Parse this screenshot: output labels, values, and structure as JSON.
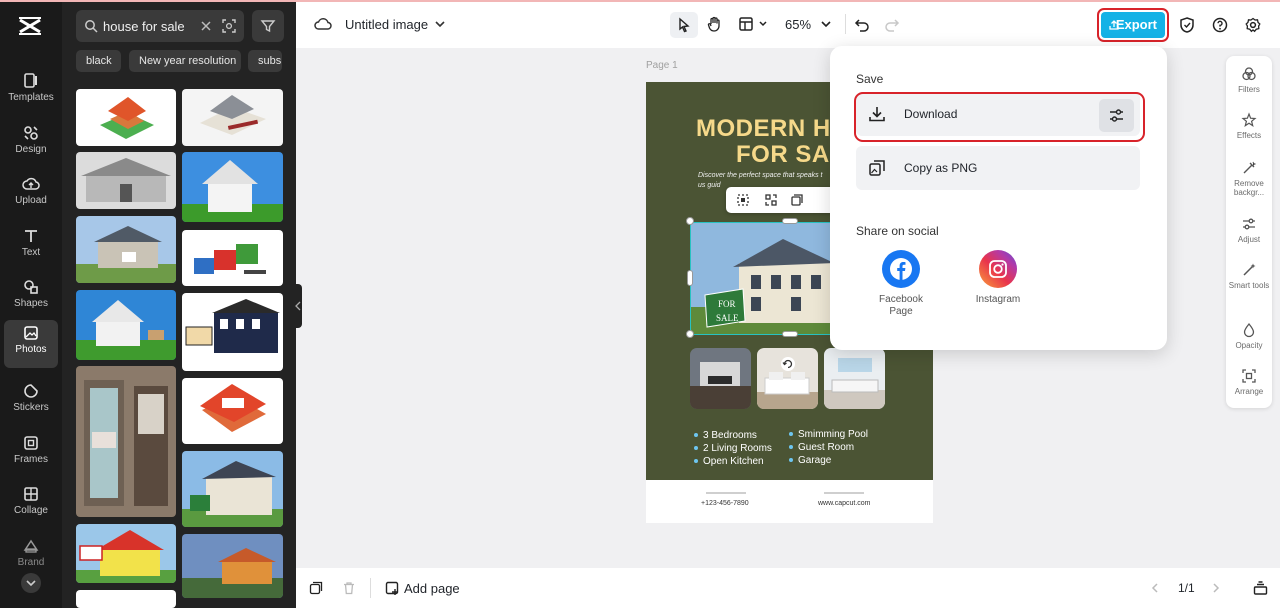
{
  "left_rail": {
    "items": [
      {
        "label": "Templates",
        "icon": "templates-icon"
      },
      {
        "label": "Design",
        "icon": "design-icon"
      },
      {
        "label": "Upload",
        "icon": "upload-icon"
      },
      {
        "label": "Text",
        "icon": "text-icon"
      },
      {
        "label": "Shapes",
        "icon": "shapes-icon"
      },
      {
        "label": "Photos",
        "icon": "photos-icon",
        "active": true
      },
      {
        "label": "Stickers",
        "icon": "stickers-icon"
      },
      {
        "label": "Frames",
        "icon": "frames-icon"
      },
      {
        "label": "Collage",
        "icon": "collage-icon"
      },
      {
        "label": "Brand",
        "icon": "brand-icon"
      }
    ]
  },
  "photo_panel": {
    "search_value": "house for sale",
    "chips": [
      "black",
      "New year resolution",
      "subs"
    ]
  },
  "topbar": {
    "doc_title": "Untitled image",
    "zoom": "65%",
    "export_label": "Export",
    "accent_color": "#14b2e6",
    "highlight_color": "#d8232a"
  },
  "canvas": {
    "page_label": "Page 1",
    "design": {
      "headline_line1": "MODERN H",
      "headline_line2": "FOR SAL",
      "subcopy_line1": "Discover the perfect space that speaks t",
      "subcopy_line2": "us guid",
      "sign_line1": "FOR",
      "sign_line2": "SALE",
      "features_left": [
        "3 Bedrooms",
        "2 Living Rooms",
        "Open Kitchen"
      ],
      "features_right": [
        "Smimming Pool",
        "Guest Room",
        "Garage"
      ],
      "phone": "+123-456-7890",
      "website": "www.capcut.com",
      "bg_color": "#4b5434",
      "headline_color": "#f6d98a"
    }
  },
  "export_menu": {
    "save_heading": "Save",
    "download_label": "Download",
    "copy_label": "Copy as PNG",
    "share_heading": "Share on social",
    "facebook_label_line1": "Facebook",
    "facebook_label_line2": "Page",
    "instagram_label": "Instagram"
  },
  "right_tools": [
    {
      "label": "Filters",
      "icon": "filters-icon"
    },
    {
      "label": "Effects",
      "icon": "effects-icon"
    },
    {
      "label": "Remove backgr...",
      "icon": "remove-background-icon"
    },
    {
      "label": "Adjust",
      "icon": "adjust-icon"
    },
    {
      "label": "Smart tools",
      "icon": "smart-tools-icon"
    },
    {
      "label": "Opacity",
      "icon": "opacity-icon"
    },
    {
      "label": "Arrange",
      "icon": "arrange-icon"
    }
  ],
  "bottombar": {
    "add_page_label": "Add page",
    "pager": "1/1"
  }
}
